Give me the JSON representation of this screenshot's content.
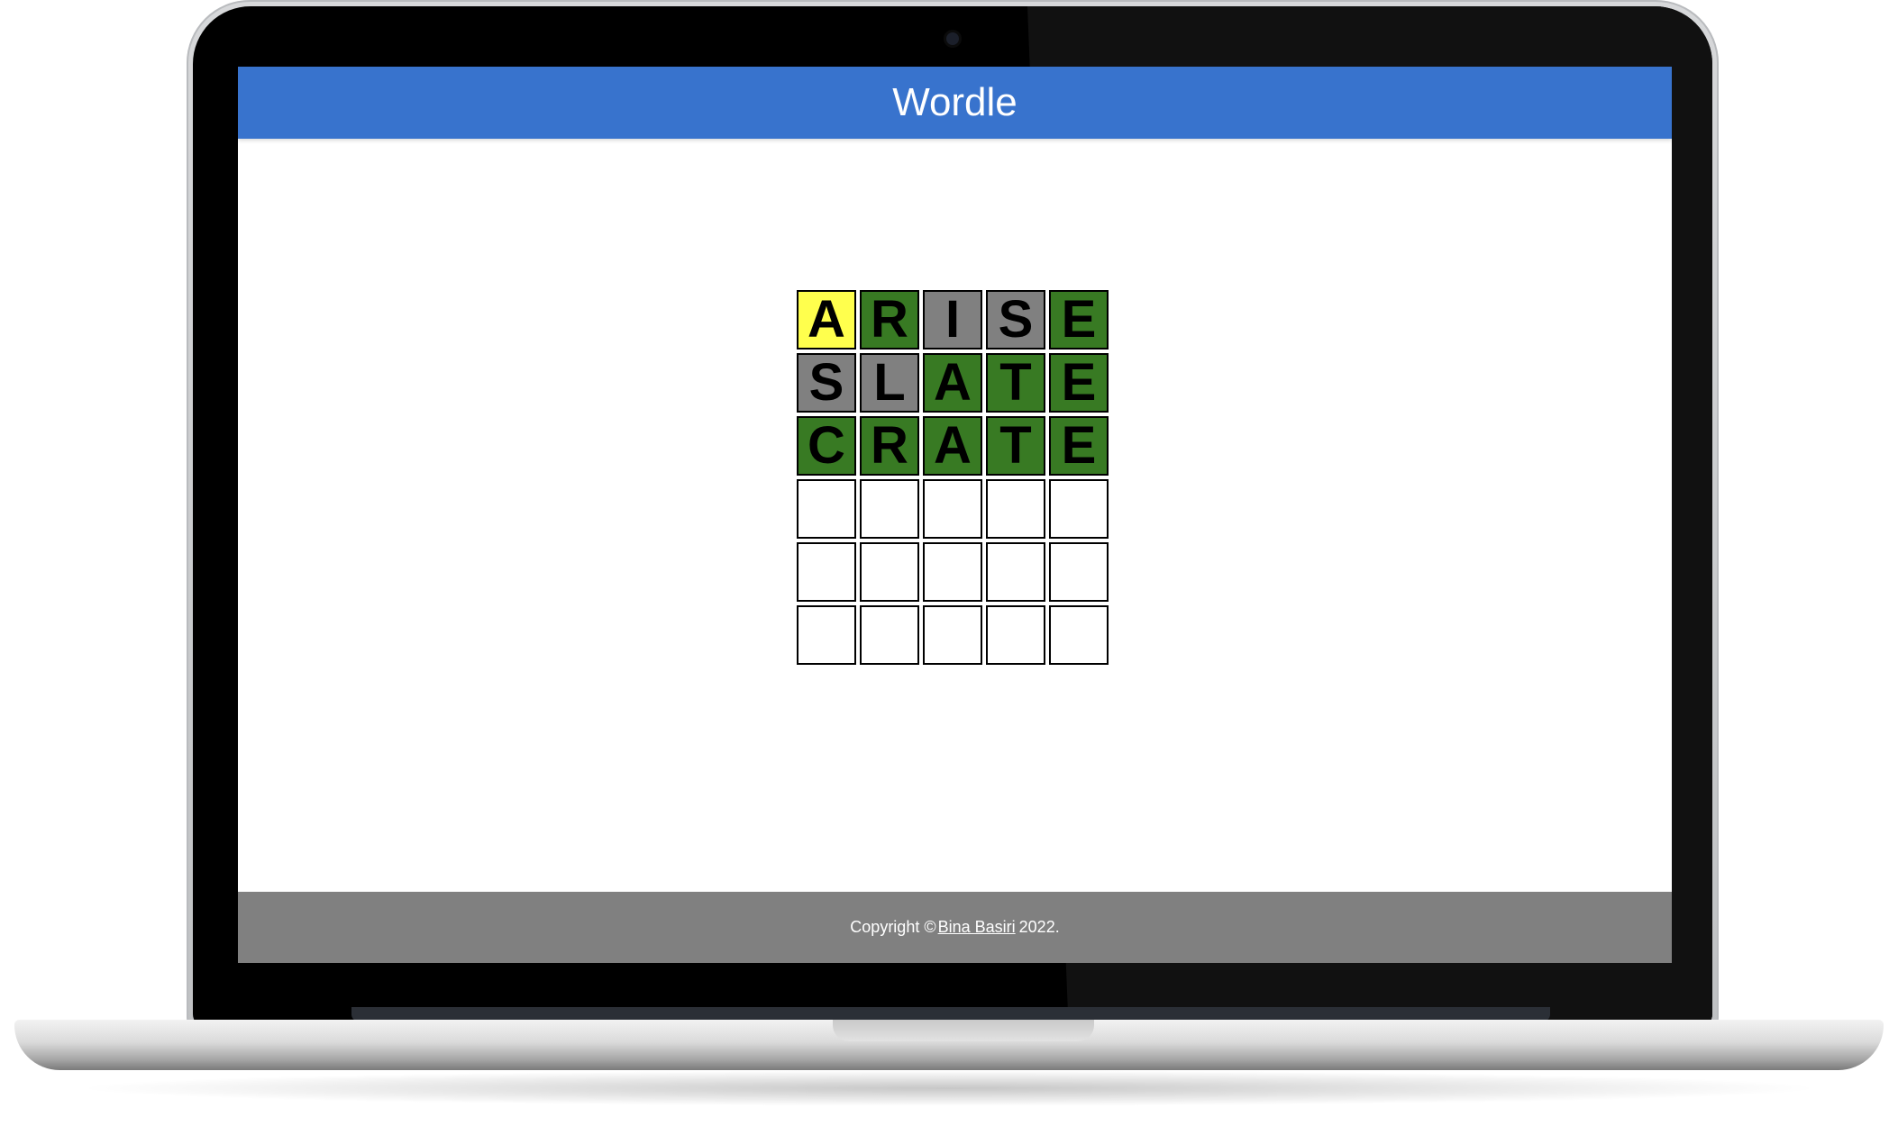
{
  "app": {
    "title": "Wordle"
  },
  "board": {
    "rows": [
      {
        "tiles": [
          {
            "letter": "A",
            "state": "present"
          },
          {
            "letter": "R",
            "state": "correct"
          },
          {
            "letter": "I",
            "state": "absent"
          },
          {
            "letter": "S",
            "state": "absent"
          },
          {
            "letter": "E",
            "state": "correct"
          }
        ]
      },
      {
        "tiles": [
          {
            "letter": "S",
            "state": "absent"
          },
          {
            "letter": "L",
            "state": "absent"
          },
          {
            "letter": "A",
            "state": "correct"
          },
          {
            "letter": "T",
            "state": "correct"
          },
          {
            "letter": "E",
            "state": "correct"
          }
        ]
      },
      {
        "tiles": [
          {
            "letter": "C",
            "state": "correct"
          },
          {
            "letter": "R",
            "state": "correct"
          },
          {
            "letter": "A",
            "state": "correct"
          },
          {
            "letter": "T",
            "state": "correct"
          },
          {
            "letter": "E",
            "state": "correct"
          }
        ]
      },
      {
        "tiles": [
          {
            "letter": "",
            "state": "empty"
          },
          {
            "letter": "",
            "state": "empty"
          },
          {
            "letter": "",
            "state": "empty"
          },
          {
            "letter": "",
            "state": "empty"
          },
          {
            "letter": "",
            "state": "empty"
          }
        ]
      },
      {
        "tiles": [
          {
            "letter": "",
            "state": "empty"
          },
          {
            "letter": "",
            "state": "empty"
          },
          {
            "letter": "",
            "state": "empty"
          },
          {
            "letter": "",
            "state": "empty"
          },
          {
            "letter": "",
            "state": "empty"
          }
        ]
      },
      {
        "tiles": [
          {
            "letter": "",
            "state": "empty"
          },
          {
            "letter": "",
            "state": "empty"
          },
          {
            "letter": "",
            "state": "empty"
          },
          {
            "letter": "",
            "state": "empty"
          },
          {
            "letter": "",
            "state": "empty"
          }
        ]
      }
    ]
  },
  "footer": {
    "prefix": "Copyright ©",
    "author_link": "Bina Basiri",
    "suffix": "2022."
  },
  "colors": {
    "header_bg": "#3873cd",
    "correct": "#387a23",
    "present": "#ffff4d",
    "absent": "#808080",
    "footer_bg": "#808080"
  }
}
